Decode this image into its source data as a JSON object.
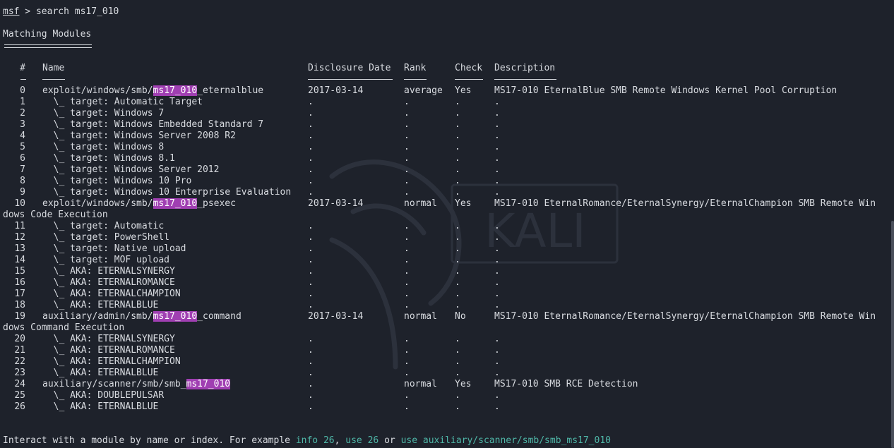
{
  "prompt": {
    "msf": "msf",
    "gt": " > ",
    "command": "search ms17_010"
  },
  "heading": "Matching Modules",
  "headers": {
    "num": "#",
    "name": "Name",
    "date": "Disclosure Date",
    "rank": "Rank",
    "check": "Check",
    "desc": "Description"
  },
  "rows": [
    {
      "num": "0",
      "name": [
        "exploit/windows/smb/",
        "ms17_010",
        "_eternalblue"
      ],
      "date": "2017-03-14",
      "rank": "average",
      "check": "Yes",
      "desc": "MS17-010 EternalBlue SMB Remote Windows Kernel Pool Corruption"
    },
    {
      "num": "1",
      "name": [
        "  \\_ target: Automatic Target"
      ],
      "date": ".",
      "rank": ".",
      "check": ".",
      "desc": "."
    },
    {
      "num": "2",
      "name": [
        "  \\_ target: Windows 7"
      ],
      "date": ".",
      "rank": ".",
      "check": ".",
      "desc": "."
    },
    {
      "num": "3",
      "name": [
        "  \\_ target: Windows Embedded Standard 7"
      ],
      "date": ".",
      "rank": ".",
      "check": ".",
      "desc": "."
    },
    {
      "num": "4",
      "name": [
        "  \\_ target: Windows Server 2008 R2"
      ],
      "date": ".",
      "rank": ".",
      "check": ".",
      "desc": "."
    },
    {
      "num": "5",
      "name": [
        "  \\_ target: Windows 8"
      ],
      "date": ".",
      "rank": ".",
      "check": ".",
      "desc": "."
    },
    {
      "num": "6",
      "name": [
        "  \\_ target: Windows 8.1"
      ],
      "date": ".",
      "rank": ".",
      "check": ".",
      "desc": "."
    },
    {
      "num": "7",
      "name": [
        "  \\_ target: Windows Server 2012"
      ],
      "date": ".",
      "rank": ".",
      "check": ".",
      "desc": "."
    },
    {
      "num": "8",
      "name": [
        "  \\_ target: Windows 10 Pro"
      ],
      "date": ".",
      "rank": ".",
      "check": ".",
      "desc": "."
    },
    {
      "num": "9",
      "name": [
        "  \\_ target: Windows 10 Enterprise Evaluation"
      ],
      "date": ".",
      "rank": ".",
      "check": ".",
      "desc": "."
    },
    {
      "num": "10",
      "name": [
        "exploit/windows/smb/",
        "ms17_010",
        "_psexec"
      ],
      "date": "2017-03-14",
      "rank": "normal",
      "check": "Yes",
      "desc": "MS17-010 EternalRomance/EternalSynergy/EternalChampion SMB Remote Win",
      "wrap": "dows Code Execution"
    },
    {
      "num": "11",
      "name": [
        "  \\_ target: Automatic"
      ],
      "date": ".",
      "rank": ".",
      "check": ".",
      "desc": "."
    },
    {
      "num": "12",
      "name": [
        "  \\_ target: PowerShell"
      ],
      "date": ".",
      "rank": ".",
      "check": ".",
      "desc": "."
    },
    {
      "num": "13",
      "name": [
        "  \\_ target: Native upload"
      ],
      "date": ".",
      "rank": ".",
      "check": ".",
      "desc": "."
    },
    {
      "num": "14",
      "name": [
        "  \\_ target: MOF upload"
      ],
      "date": ".",
      "rank": ".",
      "check": ".",
      "desc": "."
    },
    {
      "num": "15",
      "name": [
        "  \\_ AKA: ETERNALSYNERGY"
      ],
      "date": ".",
      "rank": ".",
      "check": ".",
      "desc": "."
    },
    {
      "num": "16",
      "name": [
        "  \\_ AKA: ETERNALROMANCE"
      ],
      "date": ".",
      "rank": ".",
      "check": ".",
      "desc": "."
    },
    {
      "num": "17",
      "name": [
        "  \\_ AKA: ETERNALCHAMPION"
      ],
      "date": ".",
      "rank": ".",
      "check": ".",
      "desc": "."
    },
    {
      "num": "18",
      "name": [
        "  \\_ AKA: ETERNALBLUE"
      ],
      "date": ".",
      "rank": ".",
      "check": ".",
      "desc": "."
    },
    {
      "num": "19",
      "name": [
        "auxiliary/admin/smb/",
        "ms17_010",
        "_command"
      ],
      "date": "2017-03-14",
      "rank": "normal",
      "check": "No",
      "desc": "MS17-010 EternalRomance/EternalSynergy/EternalChampion SMB Remote Win",
      "wrap": "dows Command Execution"
    },
    {
      "num": "20",
      "name": [
        "  \\_ AKA: ETERNALSYNERGY"
      ],
      "date": ".",
      "rank": ".",
      "check": ".",
      "desc": "."
    },
    {
      "num": "21",
      "name": [
        "  \\_ AKA: ETERNALROMANCE"
      ],
      "date": ".",
      "rank": ".",
      "check": ".",
      "desc": "."
    },
    {
      "num": "22",
      "name": [
        "  \\_ AKA: ETERNALCHAMPION"
      ],
      "date": ".",
      "rank": ".",
      "check": ".",
      "desc": "."
    },
    {
      "num": "23",
      "name": [
        "  \\_ AKA: ETERNALBLUE"
      ],
      "date": ".",
      "rank": ".",
      "check": ".",
      "desc": "."
    },
    {
      "num": "24",
      "name": [
        "auxiliary/scanner/smb/smb_",
        "ms17_010",
        ""
      ],
      "date": ".",
      "rank": "normal",
      "check": "Yes",
      "desc": "MS17-010 SMB RCE Detection"
    },
    {
      "num": "25",
      "name": [
        "  \\_ AKA: DOUBLEPULSAR"
      ],
      "date": ".",
      "rank": ".",
      "check": ".",
      "desc": "."
    },
    {
      "num": "26",
      "name": [
        "  \\_ AKA: ETERNALBLUE"
      ],
      "date": ".",
      "rank": ".",
      "check": ".",
      "desc": "."
    }
  ],
  "footer": {
    "text1": "Interact with a module by name or index. For example ",
    "cmd1": "info 26",
    "sep1": ", ",
    "cmd2": "use 26",
    "sep2": " or ",
    "cmd3": "use auxiliary/scanner/smb/smb_ms17_010"
  },
  "watermark": "KALI",
  "colors": {
    "background": "#1e222b",
    "text": "#d8dbe0",
    "highlight": "#a03fb2",
    "command": "#4fb7a8"
  }
}
